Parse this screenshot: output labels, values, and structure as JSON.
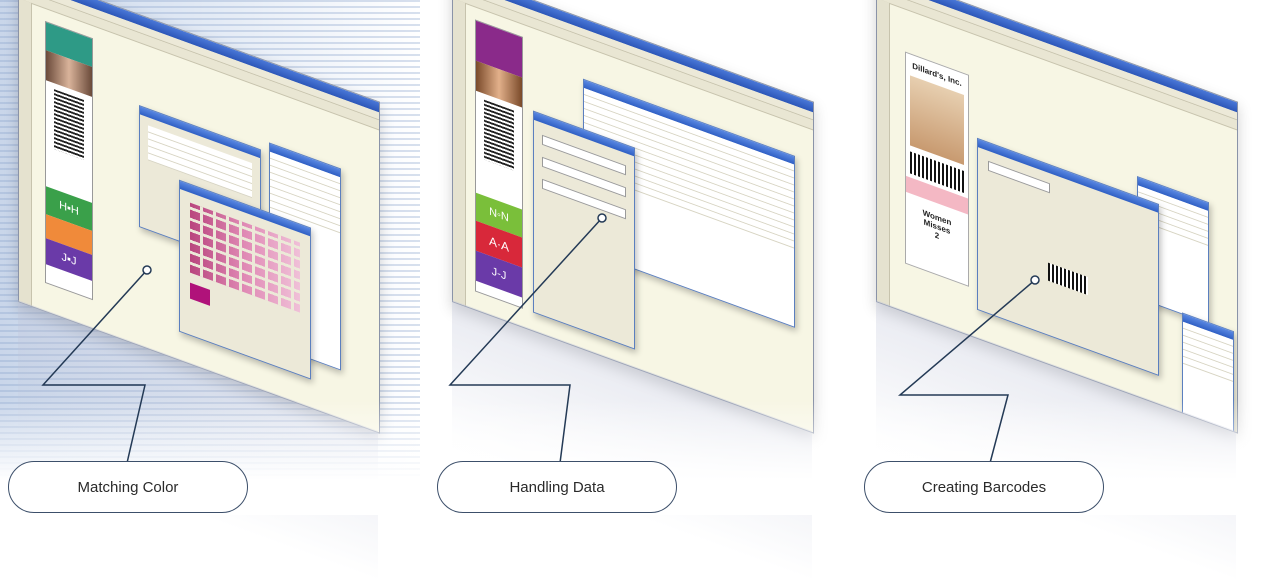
{
  "callouts": [
    {
      "label": "Matching Color"
    },
    {
      "label": "Handling Data"
    },
    {
      "label": "Creating Barcodes"
    }
  ],
  "badge_card": {
    "company": "Dillard's, Inc.",
    "department": "Women",
    "subdept": "Misses",
    "number": "2"
  },
  "tag_card_1": {
    "h": "H▪H",
    "j": "J▪J"
  },
  "tag_card_2": {
    "n": "N◦N",
    "a": "A·A",
    "j": "J-J"
  },
  "colors": {
    "accent": "#2f5fc4",
    "callout_line": "#243a56",
    "palette_swatch": "#b0127a"
  }
}
